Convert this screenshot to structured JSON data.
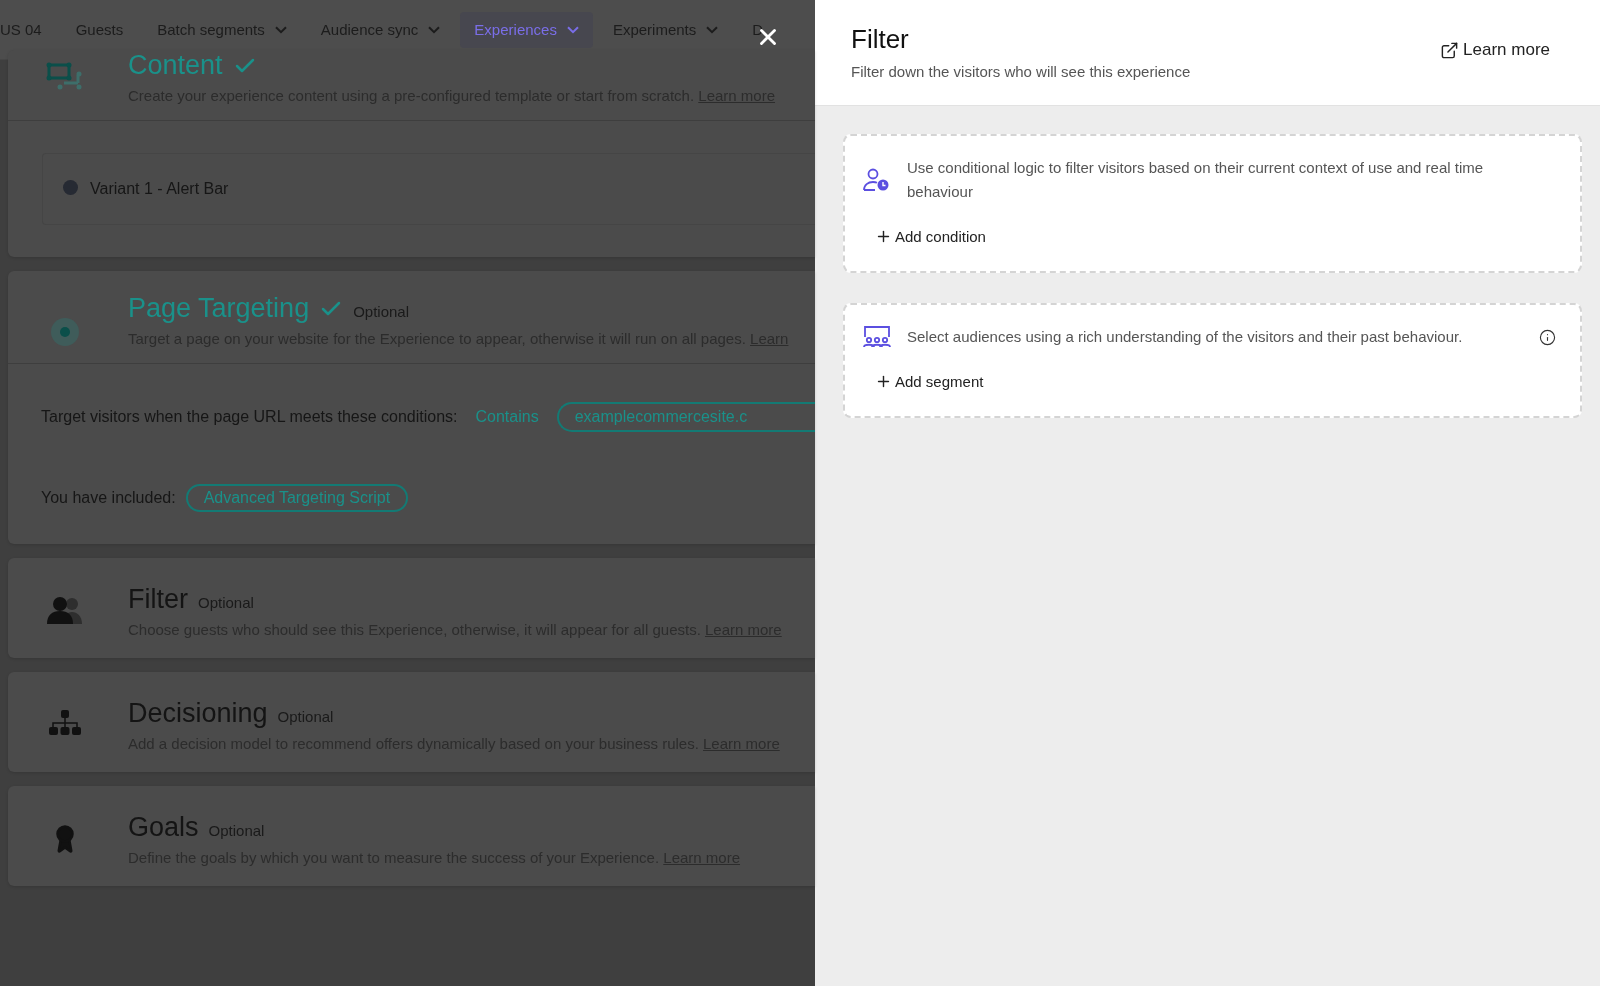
{
  "nav": {
    "items": [
      {
        "label": "US 04",
        "selected": false,
        "dropdown": false
      },
      {
        "label": "Guests",
        "selected": false,
        "dropdown": false
      },
      {
        "label": "Batch segments",
        "selected": false,
        "dropdown": true
      },
      {
        "label": "Audience sync",
        "selected": false,
        "dropdown": true
      },
      {
        "label": "Experiences",
        "selected": true,
        "dropdown": true
      },
      {
        "label": "Experiments",
        "selected": false,
        "dropdown": true
      },
      {
        "label": "D",
        "selected": false,
        "dropdown": false
      }
    ]
  },
  "sections": [
    {
      "kind": "content",
      "title": "Content",
      "done": true,
      "description": "Create your experience content using a pre-configured template or start from scratch.",
      "link": "Learn more",
      "variants": [
        "Variant 1 - Alert Bar"
      ]
    },
    {
      "kind": "targeting",
      "title": "Page Targeting",
      "done": true,
      "optional_label": "Optional",
      "description": "Target a page on your website for the Experience to appear, otherwise it will run on all pages.",
      "link": "Learn",
      "rule_label": "Target visitors when the page URL meets these conditions:",
      "operator": "Contains",
      "value": "examplecommercesite.c",
      "included_label": "You have included:",
      "included": "Advanced Targeting Script"
    },
    {
      "kind": "filter",
      "title": "Filter",
      "done": false,
      "optional_label": "Optional",
      "description": "Choose guests who should see this Experience, otherwise, it will appear for all guests.",
      "link": "Learn more"
    },
    {
      "kind": "decisioning",
      "title": "Decisioning",
      "done": false,
      "optional_label": "Optional",
      "description": "Add a decision model to recommend offers dynamically based on your business rules.",
      "link": "Learn more"
    },
    {
      "kind": "goals",
      "title": "Goals",
      "done": false,
      "optional_label": "Optional",
      "description": "Define the goals by which you want to measure the success of your Experience.",
      "link": "Learn more"
    }
  ],
  "drawer": {
    "title": "Filter",
    "subtitle": "Filter down the visitors who will see this experience",
    "learn_more": "Learn more",
    "blocks": [
      {
        "kind": "conditions",
        "text": "Use conditional logic to filter visitors based on their current context of use and real time behaviour",
        "action": "Add condition",
        "info": false
      },
      {
        "kind": "segments",
        "text": "Select audiences using a rich understanding of the visitors and their past behaviour.",
        "action": "Add segment",
        "info": true
      }
    ]
  }
}
